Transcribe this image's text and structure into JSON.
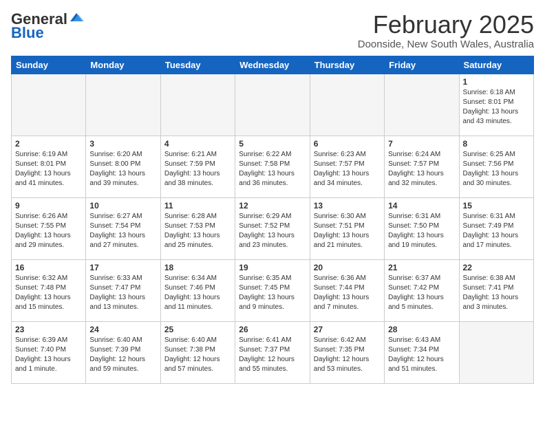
{
  "header": {
    "logo_general": "General",
    "logo_blue": "Blue",
    "month_title": "February 2025",
    "location": "Doonside, New South Wales, Australia"
  },
  "weekdays": [
    "Sunday",
    "Monday",
    "Tuesday",
    "Wednesday",
    "Thursday",
    "Friday",
    "Saturday"
  ],
  "weeks": [
    [
      {
        "day": "",
        "info": ""
      },
      {
        "day": "",
        "info": ""
      },
      {
        "day": "",
        "info": ""
      },
      {
        "day": "",
        "info": ""
      },
      {
        "day": "",
        "info": ""
      },
      {
        "day": "",
        "info": ""
      },
      {
        "day": "1",
        "info": "Sunrise: 6:18 AM\nSunset: 8:01 PM\nDaylight: 13 hours\nand 43 minutes."
      }
    ],
    [
      {
        "day": "2",
        "info": "Sunrise: 6:19 AM\nSunset: 8:01 PM\nDaylight: 13 hours\nand 41 minutes."
      },
      {
        "day": "3",
        "info": "Sunrise: 6:20 AM\nSunset: 8:00 PM\nDaylight: 13 hours\nand 39 minutes."
      },
      {
        "day": "4",
        "info": "Sunrise: 6:21 AM\nSunset: 7:59 PM\nDaylight: 13 hours\nand 38 minutes."
      },
      {
        "day": "5",
        "info": "Sunrise: 6:22 AM\nSunset: 7:58 PM\nDaylight: 13 hours\nand 36 minutes."
      },
      {
        "day": "6",
        "info": "Sunrise: 6:23 AM\nSunset: 7:57 PM\nDaylight: 13 hours\nand 34 minutes."
      },
      {
        "day": "7",
        "info": "Sunrise: 6:24 AM\nSunset: 7:57 PM\nDaylight: 13 hours\nand 32 minutes."
      },
      {
        "day": "8",
        "info": "Sunrise: 6:25 AM\nSunset: 7:56 PM\nDaylight: 13 hours\nand 30 minutes."
      }
    ],
    [
      {
        "day": "9",
        "info": "Sunrise: 6:26 AM\nSunset: 7:55 PM\nDaylight: 13 hours\nand 29 minutes."
      },
      {
        "day": "10",
        "info": "Sunrise: 6:27 AM\nSunset: 7:54 PM\nDaylight: 13 hours\nand 27 minutes."
      },
      {
        "day": "11",
        "info": "Sunrise: 6:28 AM\nSunset: 7:53 PM\nDaylight: 13 hours\nand 25 minutes."
      },
      {
        "day": "12",
        "info": "Sunrise: 6:29 AM\nSunset: 7:52 PM\nDaylight: 13 hours\nand 23 minutes."
      },
      {
        "day": "13",
        "info": "Sunrise: 6:30 AM\nSunset: 7:51 PM\nDaylight: 13 hours\nand 21 minutes."
      },
      {
        "day": "14",
        "info": "Sunrise: 6:31 AM\nSunset: 7:50 PM\nDaylight: 13 hours\nand 19 minutes."
      },
      {
        "day": "15",
        "info": "Sunrise: 6:31 AM\nSunset: 7:49 PM\nDaylight: 13 hours\nand 17 minutes."
      }
    ],
    [
      {
        "day": "16",
        "info": "Sunrise: 6:32 AM\nSunset: 7:48 PM\nDaylight: 13 hours\nand 15 minutes."
      },
      {
        "day": "17",
        "info": "Sunrise: 6:33 AM\nSunset: 7:47 PM\nDaylight: 13 hours\nand 13 minutes."
      },
      {
        "day": "18",
        "info": "Sunrise: 6:34 AM\nSunset: 7:46 PM\nDaylight: 13 hours\nand 11 minutes."
      },
      {
        "day": "19",
        "info": "Sunrise: 6:35 AM\nSunset: 7:45 PM\nDaylight: 13 hours\nand 9 minutes."
      },
      {
        "day": "20",
        "info": "Sunrise: 6:36 AM\nSunset: 7:44 PM\nDaylight: 13 hours\nand 7 minutes."
      },
      {
        "day": "21",
        "info": "Sunrise: 6:37 AM\nSunset: 7:42 PM\nDaylight: 13 hours\nand 5 minutes."
      },
      {
        "day": "22",
        "info": "Sunrise: 6:38 AM\nSunset: 7:41 PM\nDaylight: 13 hours\nand 3 minutes."
      }
    ],
    [
      {
        "day": "23",
        "info": "Sunrise: 6:39 AM\nSunset: 7:40 PM\nDaylight: 13 hours\nand 1 minute."
      },
      {
        "day": "24",
        "info": "Sunrise: 6:40 AM\nSunset: 7:39 PM\nDaylight: 12 hours\nand 59 minutes."
      },
      {
        "day": "25",
        "info": "Sunrise: 6:40 AM\nSunset: 7:38 PM\nDaylight: 12 hours\nand 57 minutes."
      },
      {
        "day": "26",
        "info": "Sunrise: 6:41 AM\nSunset: 7:37 PM\nDaylight: 12 hours\nand 55 minutes."
      },
      {
        "day": "27",
        "info": "Sunrise: 6:42 AM\nSunset: 7:35 PM\nDaylight: 12 hours\nand 53 minutes."
      },
      {
        "day": "28",
        "info": "Sunrise: 6:43 AM\nSunset: 7:34 PM\nDaylight: 12 hours\nand 51 minutes."
      },
      {
        "day": "",
        "info": ""
      }
    ]
  ]
}
